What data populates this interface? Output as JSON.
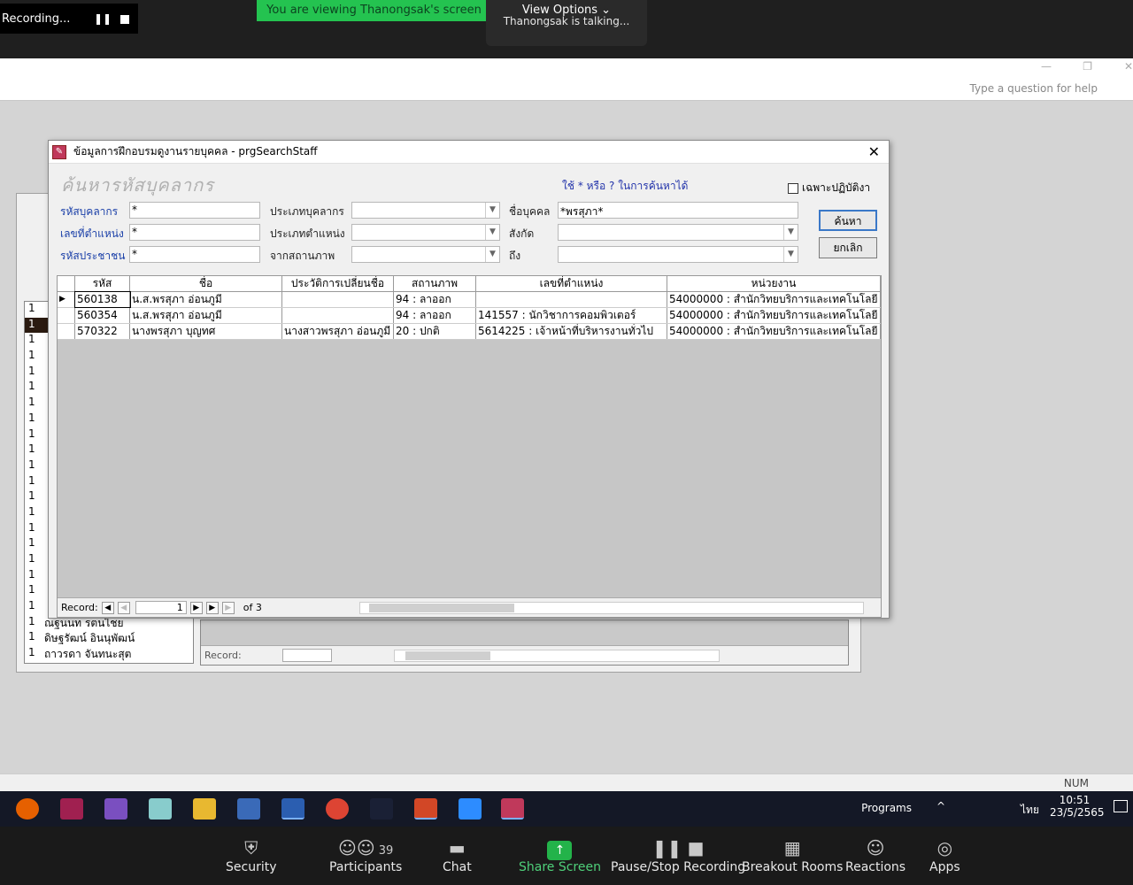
{
  "zoom": {
    "recording_label": "Recording...",
    "viewing_banner": "You are viewing Thanongsak's screen",
    "view_options": "View Options ⌄",
    "talking": "Thanongsak is talking...",
    "bottom": [
      {
        "label": "Security",
        "icon": "shield-icon"
      },
      {
        "label": "Participants",
        "icon": "participants-icon",
        "count": "39"
      },
      {
        "label": "Chat",
        "icon": "chat-icon"
      },
      {
        "label": "Share Screen",
        "icon": "share-icon"
      },
      {
        "label": "Pause/Stop Recording",
        "icon": "pause-stop-icon"
      },
      {
        "label": "Breakout Rooms",
        "icon": "breakout-icon"
      },
      {
        "label": "Reactions",
        "icon": "reactions-icon"
      },
      {
        "label": "Apps",
        "icon": "apps-icon"
      }
    ]
  },
  "access": {
    "help_placeholder": "Type a question for help",
    "status_num": "NUM"
  },
  "bg_form": {
    "list": [
      [
        "1",
        ""
      ],
      [
        "1",
        ""
      ],
      [
        "1",
        ""
      ],
      [
        "1",
        ""
      ],
      [
        "1",
        ""
      ],
      [
        "1",
        ""
      ],
      [
        "1",
        ""
      ],
      [
        "1",
        ""
      ],
      [
        "1",
        ""
      ],
      [
        "1",
        ""
      ],
      [
        "1",
        ""
      ],
      [
        "1",
        ""
      ],
      [
        "1",
        ""
      ],
      [
        "1",
        ""
      ],
      [
        "1",
        ""
      ],
      [
        "1",
        ""
      ],
      [
        "1",
        ""
      ],
      [
        "1",
        ""
      ],
      [
        "1",
        ""
      ],
      [
        "1",
        ""
      ],
      [
        "1",
        "ณฐนนท รตนไชย"
      ],
      [
        "1",
        "ดิษฐรัฒน์ อินนุพัฒน์"
      ],
      [
        "1",
        "ถาวรดา จันทนะสุต"
      ]
    ],
    "record_label": "Record:"
  },
  "dialog": {
    "title": "ข้อมูลการฝึกอบรมดูงานรายบุคคล - prgSearchStaff",
    "header": "ค้นหารหัสบุคลากร",
    "hint": "ใช้  * หรือ ? ในการค้นหาได้",
    "checkbox_label": "เฉพาะปฏิบัติงา",
    "fields": {
      "staff_id_label": "รหัสบุคลากร",
      "staff_id_value": "*",
      "position_no_label": "เลขที่ตำแหน่ง",
      "position_no_value": "*",
      "citizen_id_label": "รหัสประชาชน",
      "citizen_id_value": "*",
      "staff_type_label": "ประเภทบุคลากร",
      "position_type_label": "ประเภทตำแหน่ง",
      "status_from_label": "จากสถานภาพ",
      "name_label": "ชื่อบุคคล",
      "name_value": "*พรสุภา*",
      "affiliation_label": "สังกัด",
      "to_label": "ถึง"
    },
    "search_button": "ค้นหา",
    "cancel_button": "ยกเลิก",
    "columns": [
      "รหัส",
      "ชื่อ",
      "ประวัติการเปลี่ยนชื่อ",
      "สถานภาพ",
      "เลขที่ตำแหน่ง",
      "หน่วยงาน"
    ],
    "rows": [
      [
        "560138",
        "น.ส.พรสุภา อ่อนภูมี",
        "",
        "94 : ลาออก",
        "",
        "54000000 : สำนักวิทยบริการและเทคโนโลยี"
      ],
      [
        "560354",
        "น.ส.พรสุภา อ่อนภูมี",
        "",
        "94 : ลาออก",
        "141557 : นักวิชาการคอมพิวเตอร์",
        "54000000 : สำนักวิทยบริการและเทคโนโลยี"
      ],
      [
        "570322",
        "นางพรสุภา บุญทศ",
        "นางสาวพรสุภา อ่อนภูมี",
        "20 : ปกติ",
        "5614225 : เจ้าหน้าที่บริหารงานทั่วไป",
        "54000000 : สำนักวิทยบริการและเทคโนโลยี"
      ]
    ],
    "record_label": "Record:",
    "record_current": "1",
    "record_of": "of 3"
  },
  "taskbar": {
    "programs": "Programs",
    "lang": "ไทย",
    "time": "10:51",
    "date": "23/5/2565"
  }
}
